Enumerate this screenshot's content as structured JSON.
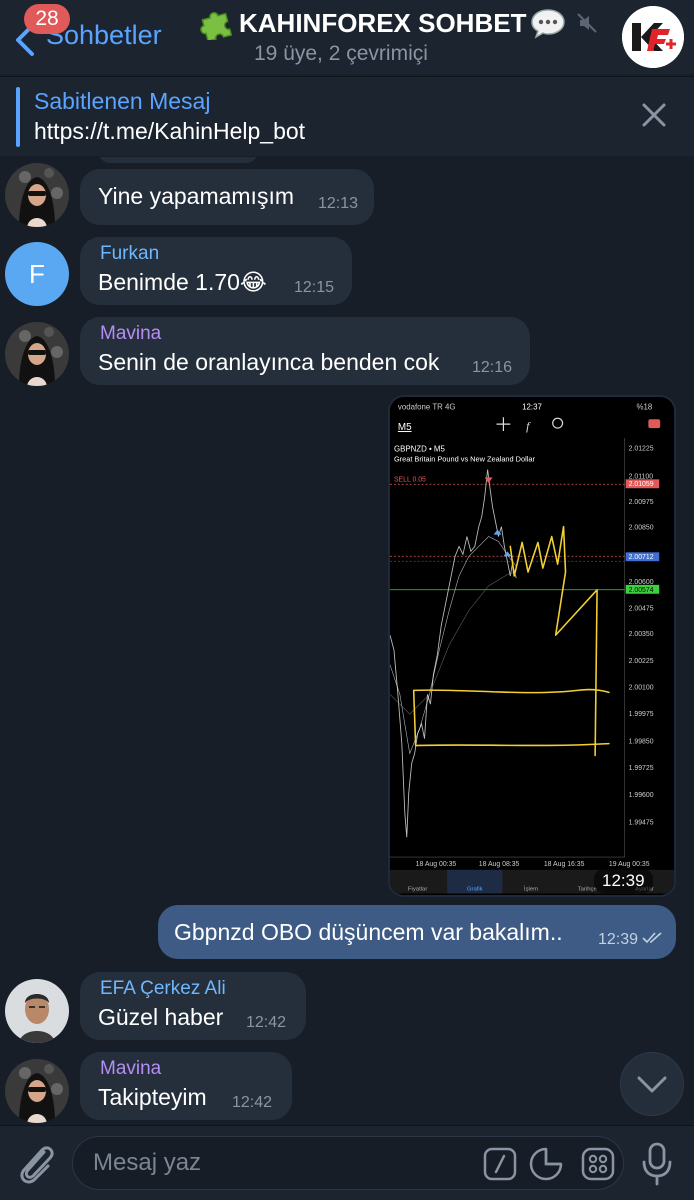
{
  "header": {
    "back_label": "Sohbetler",
    "unread_count": "28",
    "title": "KAHINFOREX SOHBET",
    "subtitle": "19 üye, 2 çevrimiçi",
    "avatar_logo": "K+"
  },
  "pinned": {
    "title": "Sabitlenen Mesaj",
    "text": "https://t.me/KahinHelp_bot"
  },
  "messages": [
    {
      "sender": "",
      "text": "Yine yapamamışım",
      "time": "12:13",
      "avatar": "woman-photo"
    },
    {
      "sender": "Furkan",
      "sender_color": "#6fb7ff",
      "text": "Benimde 1.70😂",
      "time": "12:15",
      "avatar_letter": "F",
      "avatar_color": "#5aa7f2"
    },
    {
      "sender": "Mavina",
      "sender_color": "#b58df5",
      "text": "Senin de oranlayınca benden cok",
      "time": "12:16",
      "avatar": "woman-photo"
    },
    {
      "outgoing": true,
      "type": "photo",
      "time": "12:39"
    },
    {
      "outgoing": true,
      "text": "Gbpnzd OBO düşüncem var bakalım..",
      "time": "12:39"
    },
    {
      "sender": "EFA Çerkez Ali",
      "sender_color": "#6fb7ff",
      "text": "Güzel haber",
      "time": "12:42",
      "avatar": "man-photo"
    },
    {
      "sender": "Mavina",
      "sender_color": "#b58df5",
      "text": "Takipteyim",
      "time": "12:42",
      "avatar": "woman-photo"
    }
  ],
  "screenshot": {
    "status_carrier": "vodafone TR  4G",
    "status_time": "12:37",
    "status_battery": "%18",
    "timeframe": "M5",
    "symbol": "GBPNZD • M5",
    "symbol_desc": "Great Britain Pound vs New Zealand Dollar",
    "sell_label": "SELL 0.05",
    "price_levels": [
      "2.01225",
      "2.01100",
      "2.01059",
      "2.00975",
      "2.00850",
      "2.00712",
      "2.00600",
      "2.00574",
      "2.00475",
      "2.00350",
      "2.00225",
      "2.00100",
      "1.99975",
      "1.99850",
      "1.99725",
      "1.99600",
      "1.99475"
    ],
    "time_labels": [
      "18 Aug 00:35",
      "18 Aug 08:35",
      "18 Aug 16:35",
      "19 Aug 00:35"
    ],
    "tabs": [
      "Fiyatlar",
      "Grafik",
      "İşlem",
      "Tarihçe",
      "Ayarlar"
    ]
  },
  "input": {
    "placeholder": "Mesaj yaz"
  },
  "colors": {
    "accent": "#5aa4ff",
    "bg": "#171e28",
    "bubble_in": "#252f3c",
    "bubble_out": "#3d5b85"
  }
}
